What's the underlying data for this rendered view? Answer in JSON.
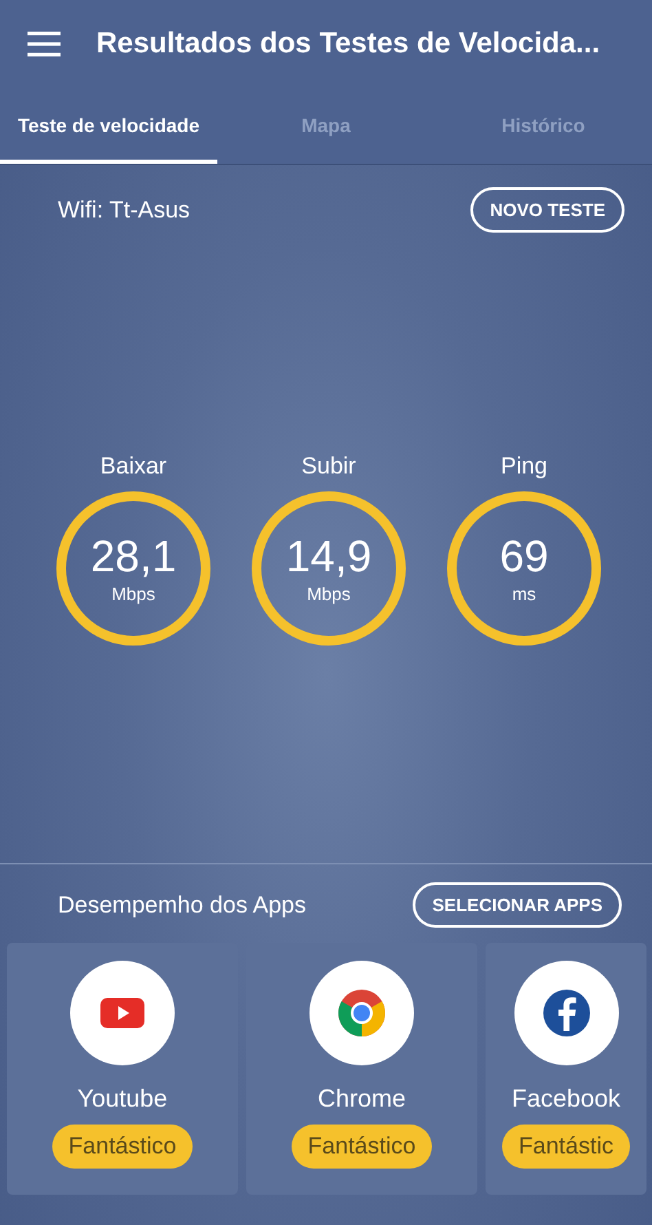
{
  "app_bar": {
    "title": "Resultados dos Testes de Velocida..."
  },
  "tabs": [
    {
      "label": "Teste de velocidade",
      "selected": true
    },
    {
      "label": "Mapa",
      "selected": false
    },
    {
      "label": "Histórico",
      "selected": false
    }
  ],
  "network": {
    "label": "Wifi: Tt-Asus",
    "button": "NOVO TESTE"
  },
  "gauges": [
    {
      "label": "Baixar",
      "value": "28,1",
      "unit": "Mbps"
    },
    {
      "label": "Subir",
      "value": "14,9",
      "unit": "Mbps"
    },
    {
      "label": "Ping",
      "value": "69",
      "unit": "ms"
    }
  ],
  "apps_section": {
    "title": "Desempemho dos Apps",
    "button": "SELECIONAR APPS"
  },
  "apps": [
    {
      "kind": "youtube",
      "name": "Youtube",
      "rating": "Fantástico"
    },
    {
      "kind": "chrome",
      "name": "Chrome",
      "rating": "Fantástico"
    },
    {
      "kind": "facebook",
      "name": "Facebook",
      "rating": "Fantástic"
    }
  ]
}
